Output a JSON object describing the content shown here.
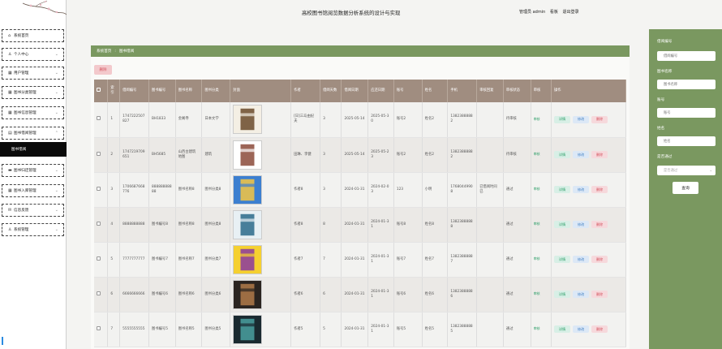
{
  "header": {
    "title": "高校图书馆阅览数据分析系统的设计与实现",
    "user_label": "管理员 admin",
    "cart_label": "看板",
    "logout_label": "退出登录"
  },
  "sidebar": {
    "items": [
      {
        "label": "系统首页",
        "icon": "home-icon"
      },
      {
        "label": "个人中心",
        "icon": "user-icon"
      },
      {
        "label": "用户管理",
        "icon": "grid-icon"
      },
      {
        "label": "图书分类管理",
        "icon": "grid-icon"
      },
      {
        "label": "图书信息管理",
        "icon": "grid-icon"
      },
      {
        "label": "图书借阅管理",
        "icon": "book-icon"
      },
      {
        "label": "图书借阅",
        "icon": ""
      },
      {
        "label": "图书归还管理",
        "icon": "folder-icon"
      },
      {
        "label": "图书入库管理",
        "icon": "grid-icon"
      },
      {
        "label": "信息反馈",
        "icon": "mail-icon"
      },
      {
        "label": "系统管理",
        "icon": "user-icon"
      }
    ]
  },
  "breadcrumb": {
    "home": "系统首页",
    "separator": ":",
    "current": "图书借阅"
  },
  "toolbar": {
    "delete_label": "删除"
  },
  "table": {
    "headers": [
      "",
      "索引",
      "借阅编号",
      "图书编号",
      "图书名称",
      "图书分类",
      "封面",
      "作者",
      "借阅天数",
      "借阅日期",
      "应还日期",
      "账号",
      "姓名",
      "手机",
      "审核回复",
      "审核状态",
      "审核",
      "操作"
    ],
    "rows": [
      {
        "idx": "1",
        "no": "1747222507827",
        "book_no": "BH1833",
        "name": "金阁寺",
        "cat": "日本文学",
        "cover": "cover-1",
        "author": "[日]三岛由纪夫",
        "days": "3",
        "borrow": "2025-05-14",
        "due": "2025-05-30",
        "acct": "账号2",
        "uname": "姓名2",
        "phone": "13823888882",
        "reply": "",
        "status": "待审核"
      },
      {
        "idx": "2",
        "no": "1747219709651",
        "book_no": "BH5685",
        "name": "山西古建筑地图",
        "cat": "建筑",
        "cover": "cover-2",
        "author": "田琳、李健",
        "days": "3",
        "borrow": "2025-05-14",
        "due": "2025-05-23",
        "acct": "账号2",
        "uname": "姓名2",
        "phone": "13823888882",
        "reply": "",
        "status": "待审核"
      },
      {
        "idx": "3",
        "no": "1706687668776",
        "book_no": "88888888888",
        "name": "图书名称8",
        "cat": "图书分类8",
        "cover": "cover-3",
        "author": "作者8",
        "days": "3",
        "borrow": "2024-01-31",
        "due": "2024-02-03",
        "acct": "123",
        "uname": "小明",
        "phone": "17680449908",
        "reply": "已借阅时间已",
        "status": "通过"
      },
      {
        "idx": "4",
        "no": "8888888888",
        "book_no": "图书编号8",
        "name": "图书名称8",
        "cat": "图书分类8",
        "cover": "cover-4",
        "author": "作者8",
        "days": "8",
        "borrow": "2024-01-31",
        "due": "2024-01-31",
        "acct": "账号8",
        "uname": "姓名8",
        "phone": "13823888888",
        "reply": "",
        "status": "通过"
      },
      {
        "idx": "5",
        "no": "7777777777",
        "book_no": "图书编号7",
        "name": "图书名称7",
        "cat": "图书分类7",
        "cover": "cover-5",
        "author": "作者7",
        "days": "7",
        "borrow": "2024-01-31",
        "due": "2024-01-31",
        "acct": "账号7",
        "uname": "姓名7",
        "phone": "13823888887",
        "reply": "",
        "status": "通过"
      },
      {
        "idx": "6",
        "no": "6666666666",
        "book_no": "图书编号6",
        "name": "图书名称6",
        "cat": "图书分类6",
        "cover": "cover-6",
        "author": "作者6",
        "days": "6",
        "borrow": "2024-01-31",
        "due": "2024-01-31",
        "acct": "账号6",
        "uname": "姓名6",
        "phone": "13823888886",
        "reply": "",
        "status": "通过"
      },
      {
        "idx": "7",
        "no": "5555555555",
        "book_no": "图书编号5",
        "name": "图书名称5",
        "cat": "图书分类5",
        "cover": "cover-7",
        "author": "作者5",
        "days": "5",
        "borrow": "2024-01-31",
        "due": "2024-01-31",
        "acct": "账号5",
        "uname": "姓名5",
        "phone": "13823888885",
        "reply": "",
        "status": "通过"
      }
    ],
    "audit_label": "审核",
    "detail_label": "详情",
    "edit_label": "修改",
    "delete_label": "删除"
  },
  "search": {
    "fields": [
      {
        "label": "借阅编号",
        "placeholder": "借阅编号"
      },
      {
        "label": "图书名称",
        "placeholder": "图书名称"
      },
      {
        "label": "账号",
        "placeholder": "账号"
      },
      {
        "label": "姓名",
        "placeholder": "姓名"
      }
    ],
    "status_label": "是否通过",
    "status_placeholder": "是否通过",
    "query_label": "查询"
  },
  "colors": {
    "accent_green": "#7a9860",
    "header_brown": "#a08d80",
    "delete_pink": "#f3c9cc"
  }
}
